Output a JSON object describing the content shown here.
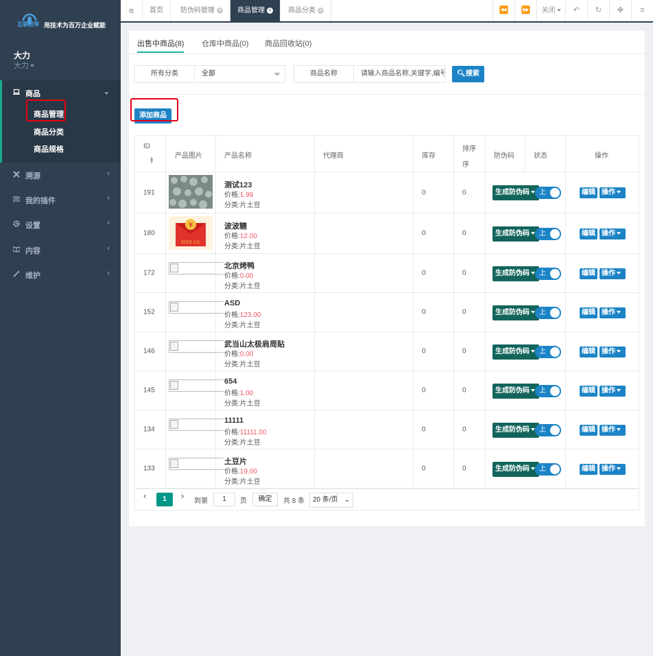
{
  "brand": {
    "logo_text": "互联纽带",
    "slogan": "用技术为百万企业赋能"
  },
  "user": {
    "name": "大力",
    "role": "大力"
  },
  "sidebar": {
    "items": [
      {
        "label": "商品",
        "icon": "laptop-icon"
      },
      {
        "label": "溯源",
        "icon": "tools-icon"
      },
      {
        "label": "我的插件",
        "icon": "keyboard-icon"
      },
      {
        "label": "设置",
        "icon": "gear-icon"
      },
      {
        "label": "内容",
        "icon": "book-icon"
      },
      {
        "label": "维护",
        "icon": "wand-icon"
      }
    ],
    "subitems": [
      "商品管理",
      "商品分类",
      "商品规格"
    ]
  },
  "topbar": {
    "menu_icon": "≡",
    "tabs": [
      "首页",
      "防伪码管理",
      "商品管理",
      "商品分类"
    ],
    "close_label": "关闭"
  },
  "subtabs": [
    "出售中商品(8)",
    "仓库中商品(0)",
    "商品回收站(0)"
  ],
  "filter": {
    "category_label": "所有分类",
    "category_value": "全部",
    "name_label": "商品名称",
    "name_placeholder": "请输入商品名称,关键字,编号",
    "search_label": "搜索"
  },
  "add_button": "添加商品",
  "table": {
    "headers": [
      "ID",
      "产品图片",
      "产品名称",
      "代理商",
      "库存",
      "排序",
      "防伪码",
      "状态",
      "操作"
    ],
    "sort_header_line2": "序",
    "price_prefix": "价格:",
    "category_prefix": "分类:",
    "fw_button": "生成防伪码",
    "toggle_label": "上",
    "edit_label": "编辑",
    "op_label": "操作",
    "rows": [
      {
        "id": "191",
        "name": "测试123",
        "price": "1.99",
        "category": "片土豆",
        "stock": "0",
        "sort": "0",
        "image": "photo"
      },
      {
        "id": "180",
        "name": "波波糖",
        "price": "12.00",
        "category": "片土豆",
        "stock": "0",
        "sort": "0",
        "image": "redpacket",
        "image_text": "红包5.2元"
      },
      {
        "id": "172",
        "name": "北京烤鸭",
        "price": "0.00",
        "category": "片土豆",
        "stock": "0",
        "sort": "0",
        "image": "broken"
      },
      {
        "id": "152",
        "name": "ASD",
        "price": "123.00",
        "category": "片土豆",
        "stock": "0",
        "sort": "0",
        "image": "broken"
      },
      {
        "id": "146",
        "name": "武当山太极肩周贴",
        "price": "0.00",
        "category": "片土豆",
        "stock": "0",
        "sort": "0",
        "image": "broken"
      },
      {
        "id": "145",
        "name": "654",
        "price": "1.00",
        "category": "片土豆",
        "stock": "0",
        "sort": "0",
        "image": "broken"
      },
      {
        "id": "134",
        "name": "11111",
        "price": "11111.00",
        "category": "片土豆",
        "stock": "0",
        "sort": "0",
        "image": "broken"
      },
      {
        "id": "133",
        "name": "土豆片",
        "price": "19.00",
        "category": "片土豆",
        "stock": "0",
        "sort": "0",
        "image": "broken"
      }
    ]
  },
  "pagination": {
    "current": "1",
    "goto_label": "到第",
    "goto_value": "1",
    "page_unit": "页",
    "confirm_label": "确定",
    "total_label": "共 8 条",
    "per_page": "20 条/页"
  },
  "colors": {
    "sidebar": "#2f4050",
    "primary": "#1c84c6",
    "dark_teal": "#13655c",
    "price_red": "#ed5565",
    "page_current": "#009688"
  }
}
